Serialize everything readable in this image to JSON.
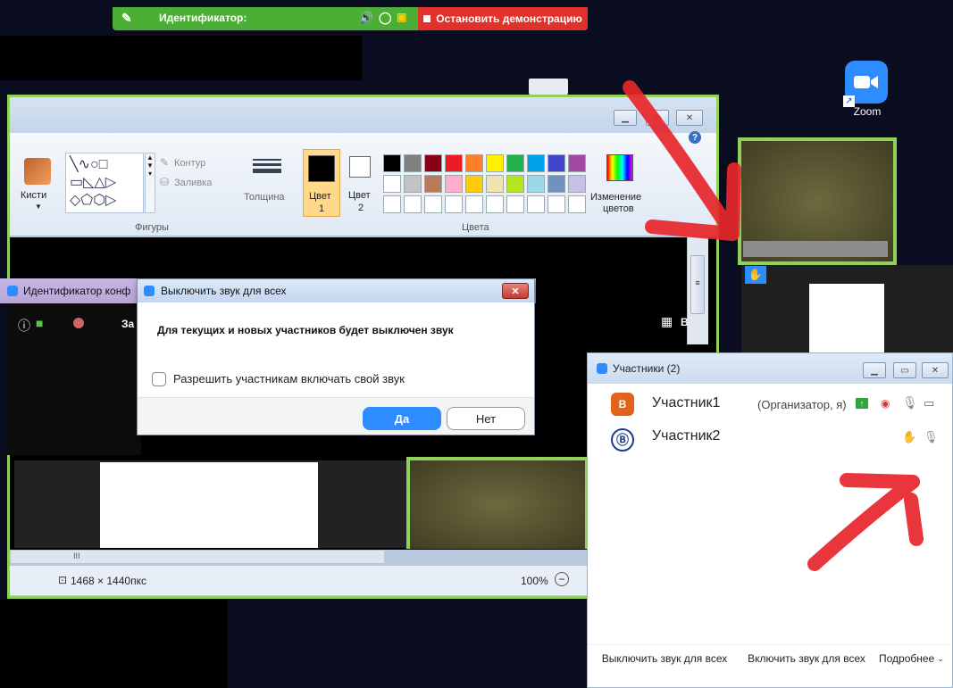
{
  "sharebar": {
    "id_label": "Идентификатор:",
    "stop_label": "Остановить демонстрацию"
  },
  "desktop": {
    "zoom_icon_label": "Zoom"
  },
  "paint": {
    "tools": {
      "brushes_label": "Кисти",
      "outline_label": "Контур",
      "fill_label": "Заливка",
      "shapes_group": "Фигуры",
      "thickness_label": "Толщина",
      "color1_label": "Цвет",
      "color1_num": "1",
      "color2_label": "Цвет",
      "color2_num": "2",
      "colors_group": "Цвета",
      "edit_colors_line1": "Изменение",
      "edit_colors_line2": "цветов"
    },
    "status": {
      "dimensions": "1468 × 1440пкс",
      "zoom": "100%",
      "scroll_grip": "III"
    },
    "palette_row1": [
      "#000000",
      "#7f7f7f",
      "#880015",
      "#ed1c24",
      "#ff7f27",
      "#fff200",
      "#22b14c",
      "#00a2e8",
      "#3f48cc",
      "#a349a4"
    ],
    "palette_row2": [
      "#ffffff",
      "#c3c3c3",
      "#b97a57",
      "#ffaec9",
      "#ffc90e",
      "#efe4b0",
      "#b5e61d",
      "#99d9ea",
      "#7092be",
      "#c8bfe7"
    ]
  },
  "meeting": {
    "id_label": "Идентификатор конф",
    "partial_label": "За",
    "right_partial": "В"
  },
  "dialog": {
    "title": "Выключить звук для всех",
    "message": "Для текущих и новых участников будет выключен звук",
    "checkbox_label": "Разрешить участникам включать свой звук",
    "yes": "Да",
    "no": "Нет"
  },
  "participants": {
    "title": "Участники (2)",
    "list": [
      {
        "avatar": "B",
        "name": "Участник1",
        "role": "(Организатор, я)",
        "avatar_color": "#e2631b"
      },
      {
        "avatar": "Ⓑ",
        "name": "Участник2",
        "role": "",
        "avatar_color": "#1b3d8f"
      }
    ],
    "mute_all": "Выключить звук для всех",
    "unmute_all": "Включить звук для всех",
    "more": "Подробнее"
  },
  "colors": {
    "zoom_blue": "#2d8cff",
    "share_green": "#4caf35",
    "stop_red": "#e0312b",
    "arrow_red": "#e8262d"
  }
}
